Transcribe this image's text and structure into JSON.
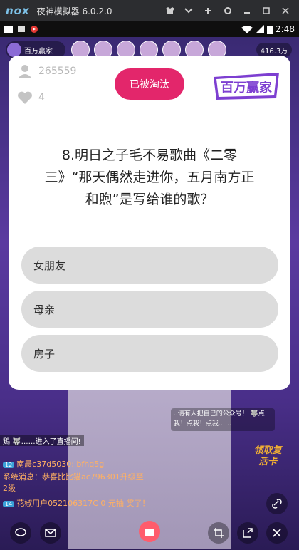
{
  "emulator": {
    "logo": "nox",
    "title": "夜神模拟器 6.0.2.0"
  },
  "status_bar": {
    "time": "2:48"
  },
  "live": {
    "host_name": "百万赢家",
    "viewer_count": "416.3万"
  },
  "card": {
    "players_remaining": "265559",
    "lives": "4",
    "eliminated_label": "已被淘汰",
    "brand_text": "百万赢家",
    "question": "8.明日之子毛不易歌曲《二零三》“那天偶然走进你，五月南方正和煦”是写给谁的歌？",
    "options": [
      "女朋友",
      "母亲",
      "房子"
    ]
  },
  "chat": {
    "enter_notice": "鶏 🐺……进入了直播间!",
    "messages": [
      {
        "badge": "12",
        "text": "南晨c37d5030: bfhq5g"
      },
      {
        "badge": "",
        "text": "系统消息：恭喜比比猫ac796301升级至2级"
      },
      {
        "badge": "14",
        "text": "花椒用户052106317C 0 元抽 奖了！"
      }
    ],
    "bubble_text": "..请有人把自己的公众号！ 🐺点我！点我！点我……",
    "resurrect_card": "领取复活卡"
  },
  "colors": {
    "accent": "#e3266b",
    "option_bg": "#dcdcdc"
  }
}
